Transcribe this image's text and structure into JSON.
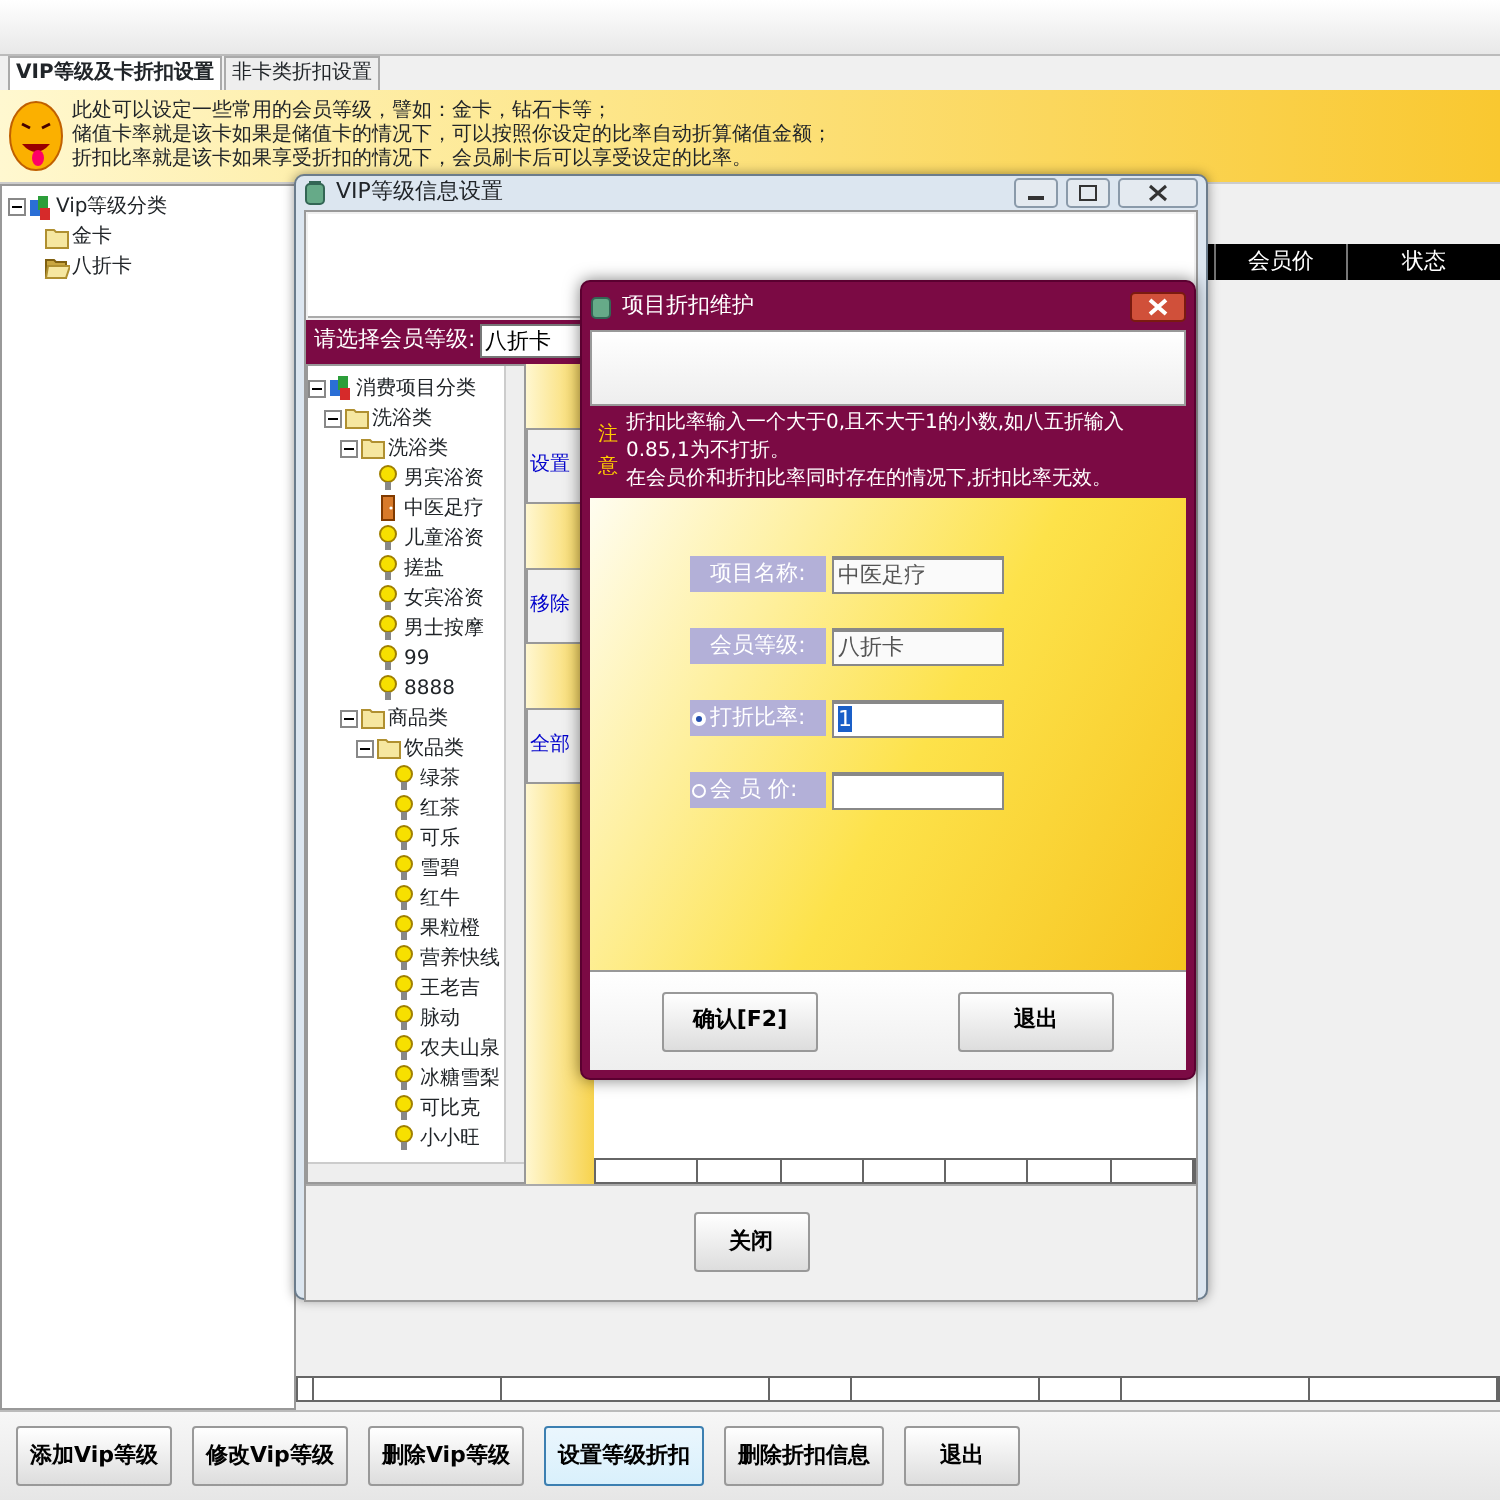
{
  "tabs": [
    {
      "label": "VIP等级及卡折扣设置",
      "selected": true
    },
    {
      "label": "非卡类折扣设置",
      "selected": false
    }
  ],
  "banner": {
    "lines": [
      "此处可以设定一些常用的会员等级，譬如：金卡，钻石卡等；",
      "储值卡率就是该卡如果是储值卡的情况下，可以按照你设定的比率自动折算储值金额；",
      "折扣比率就是该卡如果享受折扣的情况下，会员刷卡后可以享受设定的比率。"
    ]
  },
  "level_tree": {
    "label": "Vip等级分类",
    "kind": "root",
    "children": [
      {
        "label": "金卡",
        "kind": "folder"
      },
      {
        "label": "八折卡",
        "kind": "open_folder"
      }
    ]
  },
  "main_table": {
    "columns": [
      "会员价",
      "状态"
    ]
  },
  "buttons": [
    {
      "label": "添加Vip等级",
      "focused": false
    },
    {
      "label": "修改Vip等级",
      "focused": false
    },
    {
      "label": "删除Vip等级",
      "focused": false
    },
    {
      "label": "设置等级折扣",
      "focused": true
    },
    {
      "label": "删除折扣信息",
      "focused": false
    },
    {
      "label": "退出",
      "focused": false
    }
  ],
  "vip_window": {
    "title": "VIP等级信息设置",
    "level_label": "请选择会员等级:",
    "level_value": "八折卡",
    "tree": {
      "label": "消费项目分类",
      "kind": "root",
      "children": [
        {
          "label": "洗浴类",
          "kind": "folder",
          "children": [
            {
              "label": "洗浴类",
              "kind": "folder",
              "children": [
                {
                  "label": "男宾浴资",
                  "kind": "bulb"
                },
                {
                  "label": "中医足疗",
                  "kind": "door"
                },
                {
                  "label": "儿童浴资",
                  "kind": "bulb"
                },
                {
                  "label": "搓盐",
                  "kind": "bulb"
                },
                {
                  "label": "女宾浴资",
                  "kind": "bulb"
                },
                {
                  "label": "男士按摩",
                  "kind": "bulb"
                },
                {
                  "label": "99",
                  "kind": "bulb"
                },
                {
                  "label": "8888",
                  "kind": "bulb"
                }
              ]
            },
            {
              "label": "商品类",
              "kind": "folder",
              "children": [
                {
                  "label": "饮品类",
                  "kind": "folder",
                  "children": [
                    {
                      "label": "绿茶",
                      "kind": "bulb"
                    },
                    {
                      "label": "红茶",
                      "kind": "bulb"
                    },
                    {
                      "label": "可乐",
                      "kind": "bulb"
                    },
                    {
                      "label": "雪碧",
                      "kind": "bulb"
                    },
                    {
                      "label": "红牛",
                      "kind": "bulb"
                    },
                    {
                      "label": "果粒橙",
                      "kind": "bulb"
                    },
                    {
                      "label": "营养快线",
                      "kind": "bulb"
                    },
                    {
                      "label": "王老吉",
                      "kind": "bulb"
                    },
                    {
                      "label": "脉动",
                      "kind": "bulb"
                    },
                    {
                      "label": "农夫山泉",
                      "kind": "bulb"
                    },
                    {
                      "label": "冰糖雪梨",
                      "kind": "bulb"
                    },
                    {
                      "label": "可比克",
                      "kind": "bulb"
                    },
                    {
                      "label": "小小旺",
                      "kind": "bulb"
                    }
                  ]
                }
              ]
            }
          ]
        }
      ]
    },
    "side_buttons": [
      "设置",
      "移除",
      "全部"
    ],
    "close_button": "关闭"
  },
  "dialog": {
    "title": "项目折扣维护",
    "note_mark": "注意",
    "notes": [
      "折扣比率输入一个大于0,且不大于1的小数,如八五折输入0.85,1为不打折。",
      "在会员价和折扣比率同时存在的情况下,折扣比率无效。"
    ],
    "fields": [
      {
        "label": "项目名称:",
        "value": "中医足疗",
        "kind": "text"
      },
      {
        "label": "会员等级:",
        "value": "八折卡",
        "kind": "text"
      },
      {
        "label": "打折比率:",
        "value": "1",
        "kind": "radio",
        "selected": true
      },
      {
        "label": "会 员 价:",
        "kind": "radio",
        "selected": false
      }
    ],
    "buttons": [
      "确认[F2]",
      "退出"
    ]
  }
}
